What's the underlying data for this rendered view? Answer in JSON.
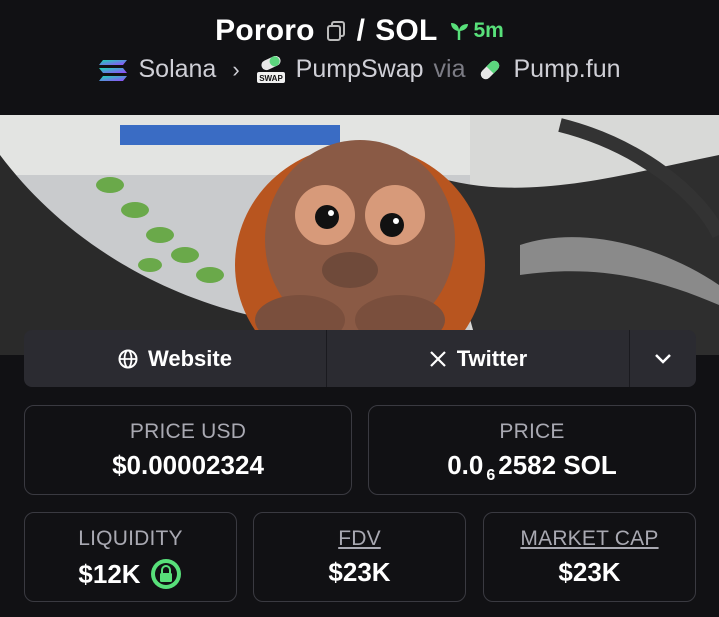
{
  "header": {
    "token": "Pororo",
    "separator": "/",
    "quote": "SOL",
    "age": "5m",
    "chain": "Solana",
    "dex": "PumpSwap",
    "via": "via",
    "launchpad": "Pump.fun"
  },
  "links": {
    "website": "Website",
    "twitter": "Twitter"
  },
  "stats": {
    "price_usd_label": "PRICE USD",
    "price_usd": "$0.00002324",
    "price_label": "PRICE",
    "price_prefix": "0.0",
    "price_zeros": "6",
    "price_suffix": "2582 SOL",
    "liquidity_label": "LIQUIDITY",
    "liquidity": "$12K",
    "fdv_label": "FDV",
    "fdv": "$23K",
    "mcap_label": "MARKET CAP",
    "mcap": "$23K"
  },
  "colors": {
    "accent_green": "#58e07a",
    "background": "#111114",
    "panel": "#2b2b31"
  }
}
